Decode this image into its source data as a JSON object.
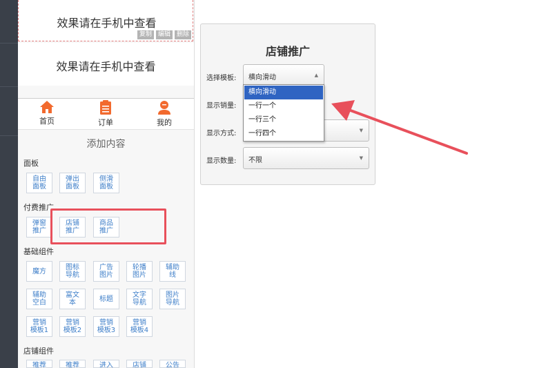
{
  "preview": {
    "text1": "效果请在手机中查看",
    "text2": "效果请在手机中查看",
    "copy": "复制",
    "edit": "编辑",
    "delete": "删除"
  },
  "nav": {
    "home": "首页",
    "orders": "订单",
    "mine": "我的"
  },
  "add_title": "添加内容",
  "sections": {
    "panel": "面板",
    "paid": "付费推广",
    "basic": "基础组件",
    "shop": "店铺组件"
  },
  "components": {
    "panel": [
      "自由面板",
      "弹出面板",
      "侧滑面板"
    ],
    "paid": [
      "弹窗推广",
      "店铺推广",
      "商品推广"
    ],
    "basic_row1": [
      "魔方",
      "图标导航",
      "广告图片",
      "轮播图片",
      "辅助线"
    ],
    "basic_row2": [
      "辅助空白",
      "富文本",
      "标题",
      "文字导航",
      "图片导航"
    ],
    "basic_row3": [
      "营销模板1",
      "营销模板2",
      "营销模板3",
      "营销模板4"
    ],
    "shop_row1": [
      "推荐",
      "推荐",
      "进入",
      "店铺",
      "公告"
    ]
  },
  "settings": {
    "title": "店铺推广",
    "template_label": "选择模板:",
    "template_value": "横向滑动",
    "sales_label": "显示销量:",
    "style_label": "显示方式:",
    "count_label": "显示数量:",
    "count_value": "不限",
    "options": [
      "横向滑动",
      "一行一个",
      "一行三个",
      "一行四个"
    ]
  },
  "colors": {
    "accent": "#f26a2e",
    "link": "#3f7fc9",
    "highlight": "#e8505b",
    "selected": "#2f64c2"
  },
  "icons": {
    "home": "home-icon",
    "orders": "clipboard-icon",
    "mine": "user-icon"
  }
}
